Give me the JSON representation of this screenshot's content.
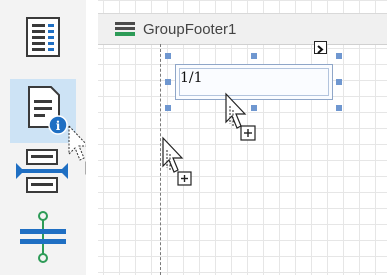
{
  "toolbox": {
    "items": [
      {
        "name": "Table of Contents",
        "icon": "table-of-contents-icon"
      },
      {
        "name": "Page Info",
        "icon": "page-info-icon",
        "selected": true
      },
      {
        "name": "Page Break",
        "icon": "page-break-icon"
      },
      {
        "name": "Cross-band Line",
        "icon": "line-split-icon"
      }
    ]
  },
  "band": {
    "title": "GroupFooter1",
    "icon": "band-icon"
  },
  "control": {
    "text": "1/1",
    "smart_tag_icon": "chevron-right-icon"
  },
  "colors": {
    "accent": "#1f6fc3",
    "selection": "#cde3f5",
    "handle": "#6f97d0"
  }
}
